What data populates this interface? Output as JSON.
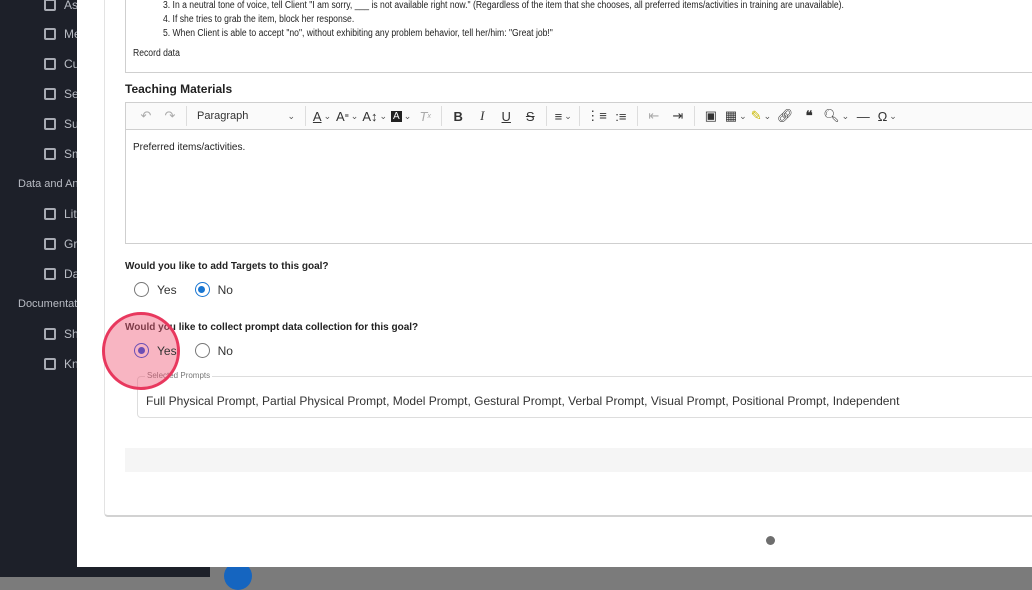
{
  "sidebar": {
    "items": [
      {
        "label": "As",
        "icon": "assessment-icon"
      },
      {
        "label": "Me",
        "icon": "measure-icon"
      },
      {
        "label": "Cu",
        "icon": "curriculum-icon"
      },
      {
        "label": "Se",
        "icon": "session-icon"
      },
      {
        "label": "Su",
        "icon": "summary-icon"
      },
      {
        "label": "Sm",
        "icon": "microphone-icon"
      }
    ],
    "section_data": "Data and Ana",
    "data_items": [
      {
        "label": "Lit",
        "icon": "library-icon"
      },
      {
        "label": "Gr",
        "icon": "graph-icon"
      },
      {
        "label": "Da",
        "icon": "dashboard-icon"
      }
    ],
    "section_docs": "Documentati",
    "doc_items": [
      {
        "label": "Sh",
        "icon": "share-icon"
      },
      {
        "label": "Kn",
        "icon": "knowledge-icon"
      }
    ]
  },
  "instructions": {
    "lines": [
      "3. In a neutral tone of voice, tell Client \"I am sorry, ___ is not available right now.\" (Regardless of the item that she chooses, all preferred items/activities in training are unavailable).",
      "4. If she tries to grab the item, block her response.",
      "5. When Client is able to accept \"no\", without exhibiting any problem behavior, tell her/him: \"Great job!\""
    ],
    "record": "Record data"
  },
  "teaching": {
    "label": "Teaching Materials",
    "paragraph": "Paragraph",
    "content": "Preferred items/activities."
  },
  "targets": {
    "question": "Would you like to add Targets to this goal?",
    "yes": "Yes",
    "no": "No",
    "selected": "No"
  },
  "prompt": {
    "question": "Would you like to collect prompt data collection for this goal?",
    "yes": "Yes",
    "no": "No",
    "selected": "Yes"
  },
  "selected_prompts": {
    "legend": "Selected Prompts",
    "value": "Full Physical Prompt, Partial Physical Prompt, Model Prompt, Gestural Prompt, Verbal Prompt, Visual Prompt, Positional Prompt, Independent"
  }
}
